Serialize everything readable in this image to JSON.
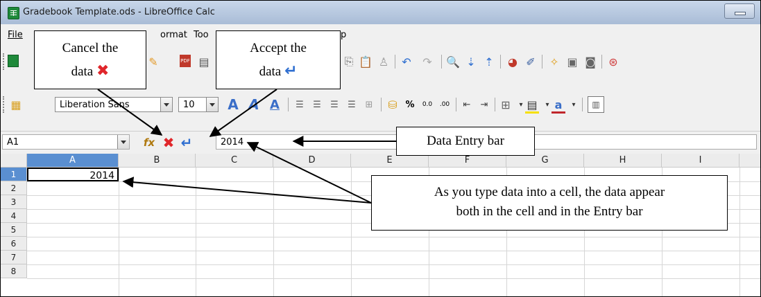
{
  "window": {
    "title": "Gradebook Template.ods - LibreOffice Calc"
  },
  "menu": {
    "items": [
      "File",
      "ormat",
      "Too",
      "p"
    ]
  },
  "font": {
    "name": "Liberation Sans",
    "size": "10"
  },
  "formula_bar": {
    "cell_reference": "A1",
    "content": "2014"
  },
  "sheet": {
    "columns": [
      "A",
      "B",
      "C",
      "D",
      "E",
      "F",
      "G",
      "H",
      "I"
    ],
    "rows": [
      "1",
      "2",
      "3",
      "4",
      "5",
      "6",
      "7",
      "8"
    ],
    "cells": {
      "A1": "2014"
    },
    "selected_column": "A",
    "selected_row": "1"
  },
  "annotations": {
    "cancel_line1": "Cancel the",
    "cancel_line2": "data",
    "accept_line1": "Accept the",
    "accept_line2": "data",
    "entry_bar": "Data Entry bar",
    "type_note_line1": "As you type data into a cell, the data appear",
    "type_note_line2": "both in the cell and in the Entry bar"
  },
  "colors": {
    "cancel_red": "#e0262b",
    "accept_blue": "#2f6fd0",
    "selection_blue": "#5a8fd1"
  }
}
